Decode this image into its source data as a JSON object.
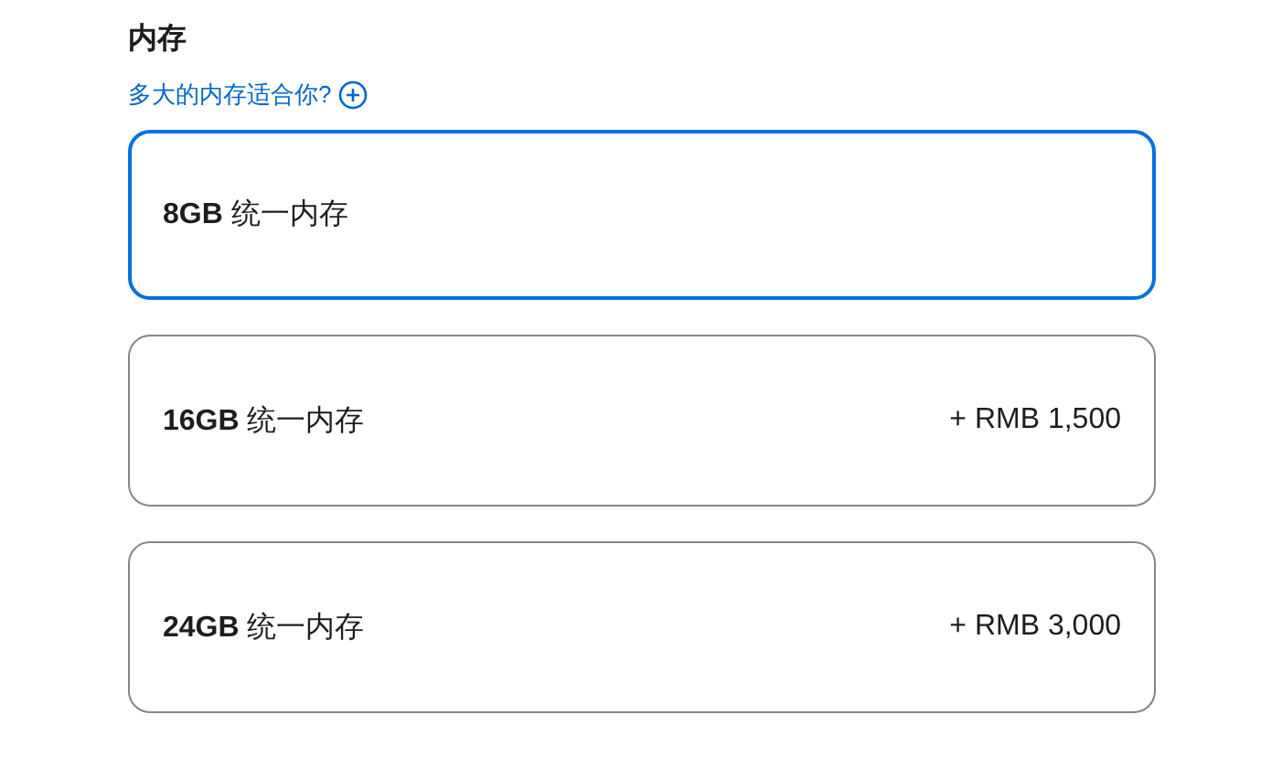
{
  "section_title": "内存",
  "help_link": {
    "text": "多大的内存适合你?"
  },
  "options": [
    {
      "capacity": "8GB",
      "label": "统一内存",
      "selected": true
    },
    {
      "capacity": "16GB",
      "label": "统一内存",
      "price": "+ RMB 1,500",
      "selected": false
    },
    {
      "capacity": "24GB",
      "label": "统一内存",
      "price": "+ RMB 3,000",
      "selected": false
    }
  ]
}
